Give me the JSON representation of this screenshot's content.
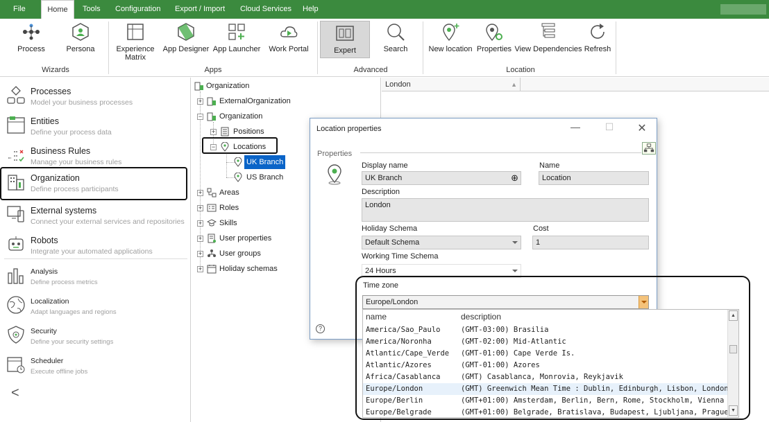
{
  "menubar": {
    "items": [
      "File",
      "Home",
      "Tools",
      "Configuration",
      "Export / Import",
      "Cloud Services",
      "Help"
    ],
    "active": "Home"
  },
  "ribbon": {
    "buttons": {
      "process": "Process",
      "persona": "Persona",
      "experience_matrix_1": "Experience",
      "experience_matrix_2": "Matrix",
      "app_designer": "App Designer",
      "app_launcher": "App Launcher",
      "work_portal": "Work Portal",
      "expert": "Expert",
      "search": "Search",
      "new_location": "New location",
      "properties": "Properties",
      "view_dependencies": "View Dependencies",
      "refresh": "Refresh"
    },
    "groups": {
      "wizards": "Wizards",
      "apps": "Apps",
      "advanced": "Advanced",
      "location": "Location"
    }
  },
  "sidebar": {
    "items": [
      {
        "title": "Processes",
        "subtitle": "Model your business processes"
      },
      {
        "title": "Entities",
        "subtitle": "Define your process data"
      },
      {
        "title": "Business Rules",
        "subtitle": "Manage your business rules"
      },
      {
        "title": "Organization",
        "subtitle": "Define process participants"
      },
      {
        "title": "External systems",
        "subtitle": "Connect your external services and repositories"
      },
      {
        "title": "Robots",
        "subtitle": "Integrate your automated applications"
      },
      {
        "title": "Analysis",
        "subtitle": "Define process metrics"
      },
      {
        "title": "Localization",
        "subtitle": "Adapt languages and regions"
      },
      {
        "title": "Security",
        "subtitle": "Define your security settings"
      },
      {
        "title": "Scheduler",
        "subtitle": "Execute offline jobs"
      }
    ],
    "collapse": "<"
  },
  "tree": {
    "root": "Organization",
    "external": "ExternalOrganization",
    "org": "Organization",
    "positions": "Positions",
    "locations": "Locations",
    "uk_branch": "UK Branch",
    "us_branch": "US Branch",
    "areas": "Areas",
    "roles": "Roles",
    "skills": "Skills",
    "user_properties": "User properties",
    "user_groups": "User groups",
    "holiday_schemas": "Holiday schemas"
  },
  "grid": {
    "column": "London"
  },
  "dialog": {
    "title": "Location properties",
    "section": "Properties",
    "display_name_label": "Display name",
    "display_name_value": "UK Branch",
    "name_label": "Name",
    "name_value": "Location",
    "description_label": "Description",
    "description_value": "London",
    "holiday_label": "Holiday Schema",
    "holiday_value": "Default Schema",
    "cost_label": "Cost",
    "cost_value": "1",
    "working_label": "Working Time Schema",
    "working_value": "24 Hours",
    "timezone_label": "Time zone",
    "timezone_value": "Europe/London",
    "help": "?"
  },
  "timezones": {
    "col_name": "name",
    "col_description": "description",
    "rows": [
      {
        "name": "America/Sao_Paulo",
        "description": "(GMT-03:00) Brasilia"
      },
      {
        "name": "America/Noronha",
        "description": "(GMT-02:00) Mid-Atlantic"
      },
      {
        "name": "Atlantic/Cape_Verde",
        "description": "(GMT-01:00) Cape Verde Is."
      },
      {
        "name": "Atlantic/Azores",
        "description": "(GMT-01:00) Azores"
      },
      {
        "name": "Africa/Casablanca",
        "description": "(GMT) Casablanca, Monrovia, Reykjavik"
      },
      {
        "name": "Europe/London",
        "description": "(GMT) Greenwich Mean Time : Dublin, Edinburgh, Lisbon, London"
      },
      {
        "name": "Europe/Berlin",
        "description": "(GMT+01:00) Amsterdam, Berlin, Bern, Rome, Stockholm, Vienna"
      },
      {
        "name": "Europe/Belgrade",
        "description": "(GMT+01:00) Belgrade, Bratislava, Budapest, Ljubljana, Prague"
      }
    ],
    "selected_index": 5
  },
  "colors": {
    "accent": "#3b8a3e",
    "selection": "#0a64c8"
  }
}
